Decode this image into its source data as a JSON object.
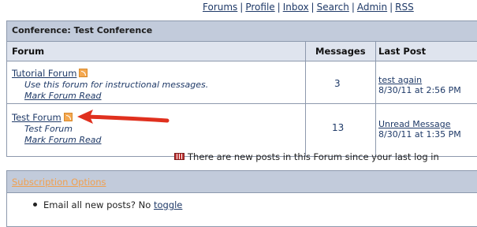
{
  "topnav": [
    "Forums",
    "Profile",
    "Inbox",
    "Search",
    "Admin",
    "RSS"
  ],
  "conference": {
    "title": "Conference: Test Conference",
    "headers": {
      "forum": "Forum",
      "messages": "Messages",
      "last_post": "Last Post"
    },
    "forums": [
      {
        "name": "Tutorial Forum",
        "description": "Use this forum for instructional messages.",
        "mark_read": "Mark Forum Read",
        "messages": "3",
        "last_post_title": "test again",
        "last_post_date": "8/30/11 at 2:56 PM"
      },
      {
        "name": "Test Forum",
        "description": "Test Forum",
        "mark_read": "Mark Forum Read",
        "messages": "13",
        "last_post_title": "Unread Message",
        "last_post_date": "8/30/11 at 1:35 PM"
      }
    ]
  },
  "legend": "There are new posts in this Forum since your last log in",
  "subscription": {
    "title": "Subscription Options",
    "email_label": "Email all new posts? No",
    "toggle": "toggle"
  },
  "colors": {
    "accent": "#c2cbdb",
    "link": "#1f3a68",
    "arrow": "#e0301e",
    "subscription_link": "#f0a050"
  },
  "icons": [
    "rss-icon",
    "new-posts-icon",
    "arrow-annotation"
  ]
}
